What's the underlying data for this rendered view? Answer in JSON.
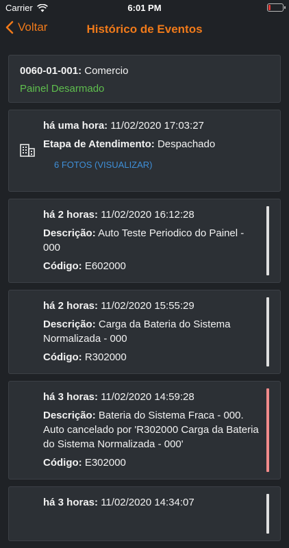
{
  "status_bar": {
    "carrier": "Carrier",
    "time": "6:01 PM",
    "battery_level": 0.15,
    "battery_color": "#e53935"
  },
  "nav": {
    "back_label": "Voltar",
    "title": "Histórico de Eventos",
    "accent": "#f07a1a"
  },
  "header_card": {
    "code": "0060-01-001:",
    "name": "Comercio",
    "status": "Painel Desarmado",
    "status_color": "#5fbf4e"
  },
  "events": [
    {
      "time_key": "há uma hora:",
      "time_value": "11/02/2020 17:03:27",
      "stage_key": "Etapa de Atendimento:",
      "stage_value": "Despachado",
      "photos_link": "6 FOTOS (VISUALIZAR)",
      "link_color": "#3f8fd8"
    },
    {
      "time_key": "há 2 horas:",
      "time_value": "11/02/2020 16:12:28",
      "desc_key": "Descrição:",
      "desc_value": "Auto Teste Periodico do Painel - 000",
      "code_key": "Código:",
      "code_value": "E602000",
      "bar_color": "#e0e0e0"
    },
    {
      "time_key": "há 2 horas:",
      "time_value": "11/02/2020 15:55:29",
      "desc_key": "Descrição:",
      "desc_value": "Carga da Bateria do Sistema Normalizada - 000",
      "code_key": "Código:",
      "code_value": "R302000",
      "bar_color": "#e0e0e0"
    },
    {
      "time_key": "há 3 horas:",
      "time_value": "11/02/2020 14:59:28",
      "desc_key": "Descrição:",
      "desc_value": "Bateria do Sistema Fraca - 000. Auto cancelado por 'R302000 Carga da Bateria do Sistema Normalizada - 000'",
      "code_key": "Código:",
      "code_value": "E302000",
      "bar_color": "#f28b8b"
    },
    {
      "time_key": "há 3 horas:",
      "time_value": "11/02/2020 14:34:07",
      "bar_color": "#e0e0e0"
    }
  ]
}
